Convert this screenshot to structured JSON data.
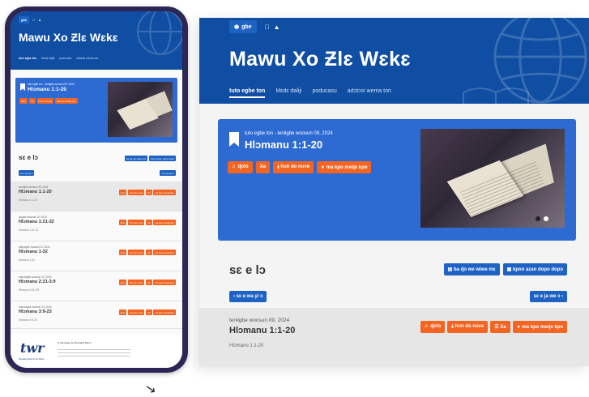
{
  "app": {
    "title": "Mawu Xo Ƶlɛ Wɛkɛ",
    "lang_label": "gbe",
    "os_icons": [
      "apple-icon",
      "android-icon"
    ]
  },
  "nav": [
    "tuto egbe ton",
    "Mɛdɛ daliji",
    "poducasu",
    "adɔtɔsi wema ton"
  ],
  "hero": {
    "meta": "tuto egbe ton - teniigbe woosun 09, 2024",
    "title": "Hlɔmanu 1:1-20",
    "buttons": [
      "ɖoto",
      "Xa",
      "hun do nuve",
      "ma kpo meɖe kpo"
    ]
  },
  "section": {
    "title": "sɛ e lɔ",
    "btn_bible": "ba ɖo we wiwe mɛ",
    "btn_calendar": "kpon azan dopo dopo",
    "prev": "sɛ e wa yi ɔ",
    "next": "sɛ e ja we ɔ"
  },
  "rows": [
    {
      "meta": "teniigbe woosun 09, 2024",
      "title": "Hlɔmanu 1:1-20",
      "sub": "Hlɔmanu 1:1-20"
    },
    {
      "meta": "tɛngbe woosun 10, 2024",
      "title": "Hlɔmanu 1:21-32",
      "sub": "Hlɔmanu 1:21-32"
    },
    {
      "meta": "ɖokpɔgbe woosun 11, 2024",
      "title": "Hlɔmanu 1-32",
      "sub": "Hlɔmanu 1-32"
    },
    {
      "meta": "nukɔnɔgbe woosun 12, 2024",
      "title": "Hlɔmanu 2:21-3:9",
      "sub": "Hlɔmanu 2:21-3:9"
    },
    {
      "meta": "nukɔnɔgbe woosun 13, 2024",
      "title": "Hlɔmanu 3:9-23",
      "sub": "Hlɔmanu 3:9-23"
    }
  ],
  "row_buttons": [
    "ɖoto",
    "hun do nuve",
    "Xa",
    "ma kpo meɖe kpo"
  ],
  "footer": {
    "logo": "twr",
    "tagline": "Speaking Hope to the World",
    "org": "le Message de l'Évangile Bénin"
  }
}
